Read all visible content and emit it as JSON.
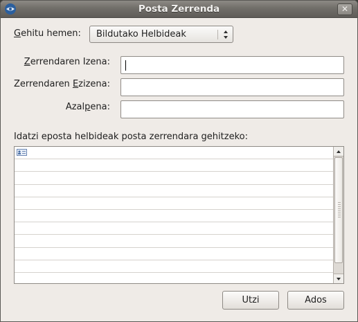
{
  "window": {
    "title": "Posta Zerrenda"
  },
  "add_to": {
    "label": "Gehitu hemen:",
    "selected": "Bildutako Helbideak"
  },
  "fields": {
    "list_name": {
      "label": "Zerrendaren Izena:",
      "value": ""
    },
    "list_nickname": {
      "label": "Zerrendaren Ezizena:",
      "value": ""
    },
    "description": {
      "label": "Azalpena:",
      "value": ""
    }
  },
  "addresses": {
    "instruction": "Idatzi eposta helbideak posta zerrendara gehitzeko:",
    "row_count": 11
  },
  "buttons": {
    "cancel": "Utzi",
    "ok": "Ados"
  },
  "icons": {
    "app": "thunderbird-icon",
    "close": "close-icon",
    "row": "address-card-icon"
  }
}
